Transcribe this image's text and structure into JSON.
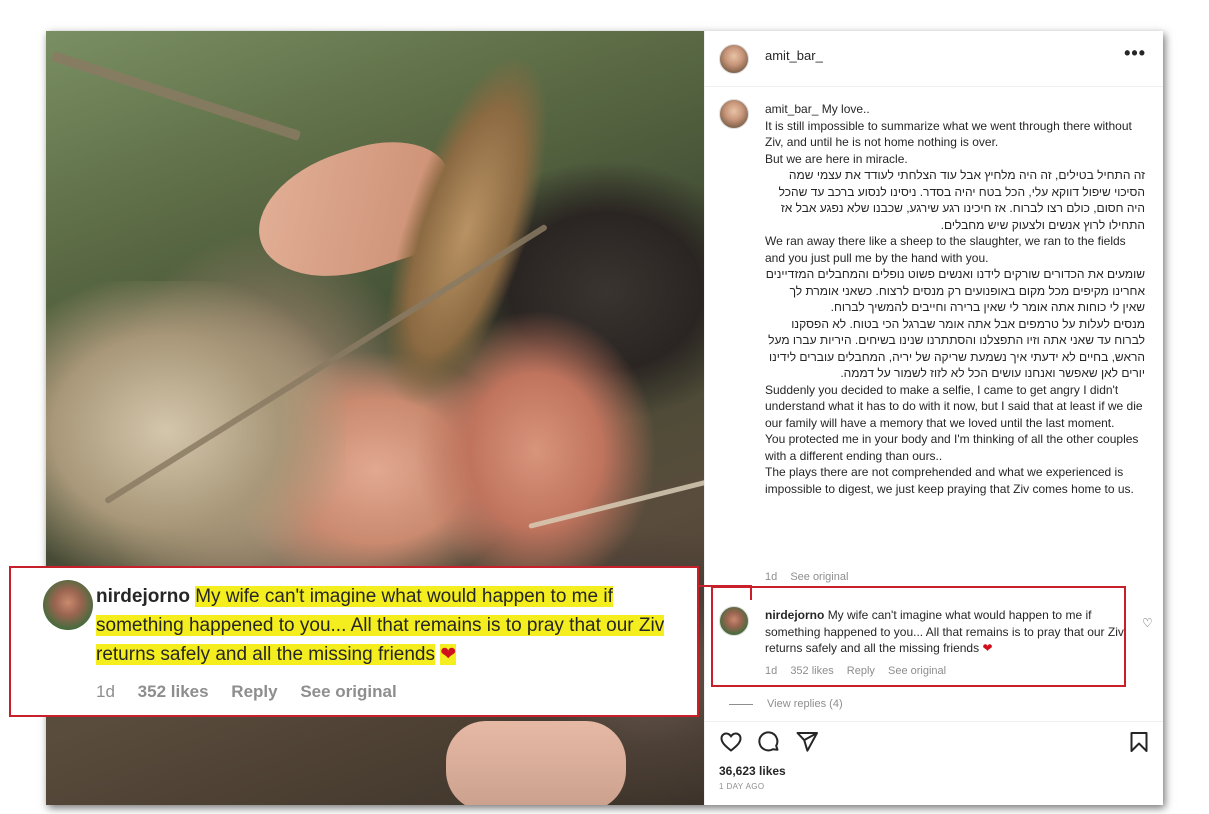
{
  "post": {
    "username": "amit_bar_",
    "more_icon": "more-horizontal-icon",
    "caption_username": "amit_bar_",
    "caption_lines": [
      {
        "text": "My love..",
        "rtl": false,
        "inline": true
      },
      {
        "text": "It is still impossible to summarize what we went through there without Ziv, and until he is not home nothing is over.",
        "rtl": false
      },
      {
        "text": "But we are here in miracle.",
        "rtl": false
      },
      {
        "text": "זה התחיל בטילים, זה היה מלחיץ אבל עוד הצלחתי לעודד את עצמי שמה הסיכוי שיפול דווקא עלי, הכל בטח יהיה בסדר. ניסינו לנסוע ברכב עד שהכל היה חסום, כולם רצו לברוח. אז חיכינו רגע שירגע, שכבנו שלא נפגע אבל אז התחילו לרוץ אנשים ולצעוק שיש מחבלים.",
        "rtl": true
      },
      {
        "text": "We ran away there like a sheep to the slaughter, we ran to the fields and you just pull me by the hand with you.",
        "rtl": false
      },
      {
        "text": "שומעים את הכדורים שורקים לידנו ואנשים פשוט נופלים והמחבלים המזדיינים אחרינו מקיפים מכל מקום באופנועים רק מנסים לרצוח. כשאני אומרת לך שאין לי כוחות אתה אומר לי שאין ברירה וחייבים להמשיך לברוח.",
        "rtl": true
      },
      {
        "text": "מנסים לעלות על טרמפים אבל אתה אומר שברגל הכי בטוח. לא הפסקנו לברוח עד שאני אתה וזיו התפצלנו והסתתרנו שנינו בשיחים. היריות עברו מעל הראש, בחיים לא ידעתי איך נשמעת שריקה של יריה, המחבלים עוברים לידינו יורים לאן שאפשר ואנחנו עושים הכל לא לזוז לשמור על דממה.",
        "rtl": true
      },
      {
        "text": "Suddenly you decided to make a selfie, I came to get angry I didn't understand what it has to do with it now, but I said that at least if we die our family will have a memory that we loved until the last moment.",
        "rtl": false
      },
      {
        "text": "You protected me in your body and I'm thinking of all the other couples with a different ending than ours..",
        "rtl": false
      },
      {
        "text": "The plays there are not comprehended and what we experienced is impossible to digest, we just keep praying that Ziv comes home to us.",
        "rtl": false
      }
    ],
    "caption_meta": {
      "age": "1d",
      "see_original": "See original"
    }
  },
  "comment": {
    "username": "nirdejorno",
    "text": "My wife can't imagine what would happen to me if something happened to you... All that remains is to pray that our Ziv returns safely and all the missing friends",
    "emoji": "❤",
    "age": "1d",
    "likes": "352 likes",
    "reply": "Reply",
    "see_original": "See original",
    "like_icon": "heart-outline-icon"
  },
  "view_replies": "View replies (4)",
  "actions": {
    "like_icon": "heart-icon",
    "comment_icon": "comment-icon",
    "share_icon": "send-icon",
    "save_icon": "bookmark-icon",
    "likes_count": "36,623 likes",
    "time_ago": "1 DAY AGO"
  },
  "callout": {
    "username": "nirdejorno",
    "text": "My wife can't imagine what would happen to me if something happened to you... All that remains is to pray that our Ziv returns safely and all the missing friends",
    "emoji": "❤",
    "age": "1d",
    "likes": "352 likes",
    "reply": "Reply",
    "see_original": "See original"
  },
  "colors": {
    "highlight": "#f5ee1e",
    "annotation_red": "#c8202a",
    "heart": "#d0101e"
  }
}
